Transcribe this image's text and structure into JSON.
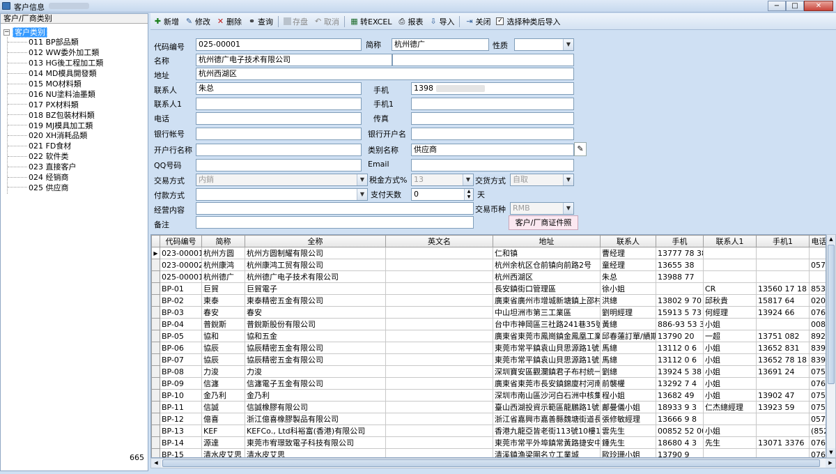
{
  "window": {
    "title": "客户信息",
    "controls": [
      "−",
      "□",
      "✕"
    ]
  },
  "left_panel": {
    "header": "客户/厂商类别",
    "root_expander": "−",
    "root": "客户类别",
    "items": [
      "011 BP部品類",
      "012 WW委外加工類",
      "013 HG後工程加工類",
      "014 MD模具開發類",
      "015 MO材料類",
      "016 NU塗料油墨類",
      "017 PX材料類",
      "018 BZ包裝材料類",
      "019 MJ模具加工類",
      "020 XH消耗品類",
      "021 FD食材",
      "022 软件类",
      "023 直接客户",
      "024 经销商",
      "025 供应商"
    ],
    "count": "665"
  },
  "toolbar": {
    "add": "新增",
    "edit": "修改",
    "delete": "删除",
    "query": "查询",
    "save": "存盘",
    "cancel": "取消",
    "excel": "转EXCEL",
    "report": "报表",
    "import": "导入",
    "close": "关闭",
    "select_import": "选择种类后导入",
    "select_import_checked": "✓"
  },
  "form": {
    "labels": {
      "code": "代码编号",
      "short": "简称",
      "nature": "性质",
      "name": "名称",
      "address": "地址",
      "contact": "联系人",
      "mobile": "手机",
      "contact1": "联系人1",
      "mobile1": "手机1",
      "phone": "电话",
      "fax": "传真",
      "bank_acct": "银行帐号",
      "bank_open": "银行开户名",
      "bank_name": "开户行名称",
      "category": "类别名称",
      "qq": "QQ号码",
      "email": "Email",
      "trade_mode": "交易方式",
      "tax_mode": "税金方式%",
      "delivery": "交货方式",
      "pay_mode": "付款方式",
      "pay_days": "支付天数",
      "day_unit": "天",
      "business": "经营内容",
      "currency": "交易币种",
      "remark": "备注",
      "cert_button": "客户/厂商证件照"
    },
    "values": {
      "code": "025-00001",
      "short": "杭州德广",
      "nature": "",
      "name": "杭州德广电子技术有限公司",
      "name_extra": "",
      "address": "杭州西湖区",
      "contact": "朱总",
      "mobile": "1398",
      "contact1": "",
      "mobile1": "",
      "phone": "",
      "fax": "",
      "bank_acct": "",
      "bank_open": "",
      "bank_name": "",
      "category": "供应商",
      "qq": "",
      "email": "",
      "trade_mode": "内銷",
      "tax_mode": "13",
      "delivery": "自取",
      "pay_mode": "",
      "pay_days": "0",
      "business": "",
      "currency": "RMB",
      "remark": ""
    }
  },
  "grid": {
    "columns": [
      "代码编号",
      "简称",
      "全称",
      "英文名",
      "地址",
      "联系人",
      "手机",
      "联系人1",
      "手机1",
      "电话"
    ],
    "rows": [
      [
        "023-00001",
        "杭州方圆",
        "杭州方圆制耀有限公司",
        "",
        "仁和镇",
        "曹经理",
        "13777 78 38",
        "",
        "",
        ""
      ],
      [
        "023-00002",
        "杭州康鸿",
        "杭州康鸿工贸有限公司",
        "",
        "杭州余杭区仓前镇向前路2号",
        "童经理",
        "13655 38",
        "",
        "",
        "057"
      ],
      [
        "025-00001",
        "杭州德广",
        "杭州德广电子技术有限公司",
        "",
        "杭州西湖区",
        "朱总",
        "13988 77",
        "",
        "",
        ""
      ],
      [
        "BP-01",
        "巨貿",
        "巨貿電子",
        "",
        "長安鎮街口管理區",
        "徐小姐",
        "",
        "CR",
        "13560 17 18",
        "853"
      ],
      [
        "BP-02",
        "東泰",
        "東泰精密五金有限公司",
        "",
        "廣東省廣州市增城新塘鎮上邵村長",
        "洪總",
        "13802 9 70",
        "邱秋貴",
        "15817 64",
        "020"
      ],
      [
        "BP-03",
        "春安",
        "春安",
        "",
        "中山坦洲市第三工業區",
        "劉明經理",
        "15913 5 73",
        "何經理",
        "13924 66",
        "076"
      ],
      [
        "BP-04",
        "普銳斯",
        "普銳斯股份有限公司",
        "",
        "台中市神岡區三社路241巷35號",
        "黃總",
        "886-93 53 39",
        "小姐",
        "",
        "008"
      ],
      [
        "BP-05",
        "協和",
        "協和五金",
        "",
        "廣東省東莞市鳳崗鎮金鳳凰工業區",
        "邱春蓮訂單/績期",
        "13790 20",
        "一超",
        "13751 082",
        "892"
      ],
      [
        "BP-06",
        "協辰",
        "協辰精密五金有限公司",
        "",
        "東莞市常平鎮袁山貝思源路1號",
        "馬總",
        "13112 0 6",
        "小姐",
        "13652 831",
        "839"
      ],
      [
        "BP-07",
        "協辰",
        "協辰精密五金有限公司",
        "",
        "東莞市常平鎮袁山貝思源路1號",
        "馬總",
        "13112 0 6",
        "小姐",
        "13652 78 18",
        "839"
      ],
      [
        "BP-08",
        "力浚",
        "力浚",
        "",
        "深圳寶安區觀瀾鎮君子布村統一工",
        "劉總",
        "13924 5 38",
        "小姐",
        "13691 24",
        "075"
      ],
      [
        "BP-09",
        "信瀍",
        "信瀍電子五金有限公司",
        "",
        "廣東省東莞市長安鎮錦廈村河南工",
        "前襲權",
        "13292 7 4",
        "小姐",
        "",
        "076"
      ],
      [
        "BP-10",
        "金乃利",
        "金乃利",
        "",
        "深圳市南山區沙河白石洲中核集團",
        "程小姐",
        "13682 49",
        "小姐",
        "13902 47",
        "075"
      ],
      [
        "BP-11",
        "信誠",
        "信誠橡膠有限公司",
        "",
        "臺山西湖投資示範區龍鵬路1號",
        "鄺曼儀小姐",
        "18933 9 3",
        "仁杰總經理",
        "13923 59",
        "075"
      ],
      [
        "BP-12",
        "億喜",
        "浙江億喜橡膠製品有限公司",
        "",
        "浙江省嘉興市嘉善縣魏塘街道長家",
        "張修敏經理",
        "13666 9 8",
        "",
        "",
        "057"
      ],
      [
        "BP-13",
        "KEF",
        "KEFCo., Ltd科裕富(香港)有限公司",
        "",
        "香港九龍亞皆老街113號10樓100室",
        "雲先生",
        "00852 52 00",
        "小姐",
        "",
        "(852"
      ],
      [
        "BP-14",
        "源達",
        "東莞市宥璟致電子科技有限公司",
        "",
        "東莞市常平外埠鎮常黃路捷安中心",
        "鍾先生",
        "18680 4 3",
        "先生",
        "13071 3376",
        "076"
      ],
      [
        "BP-15",
        "清水皮艾思",
        "清水皮艾思",
        "",
        "清溪鎮漁梁圍名立工業城",
        "歐玲珊小姐",
        "13790 9",
        "",
        "",
        "076"
      ]
    ]
  }
}
